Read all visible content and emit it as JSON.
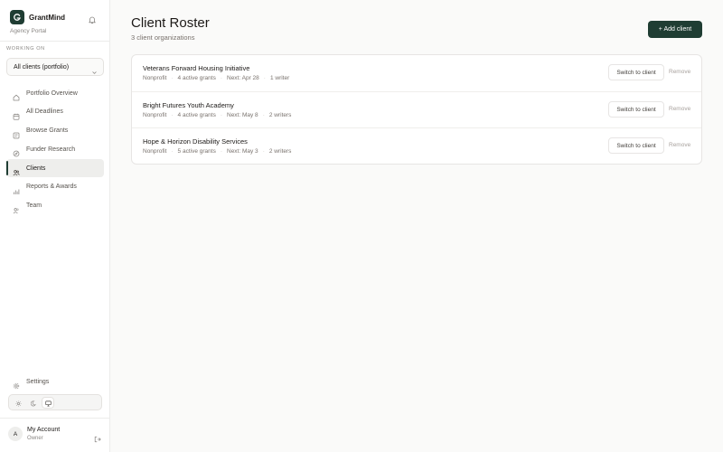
{
  "brand": {
    "name": "GrantMind",
    "subtitle": "Agency Portal"
  },
  "workspace": {
    "label": "WORKING ON",
    "selected": "All clients (portfolio)"
  },
  "nav": [
    {
      "label": "Portfolio Overview",
      "icon": "home-icon",
      "active": false
    },
    {
      "label": "All Deadlines",
      "icon": "calendar-icon",
      "active": false
    },
    {
      "label": "Browse Grants",
      "icon": "search-icon",
      "active": false
    },
    {
      "label": "Funder Research",
      "icon": "compass-icon",
      "active": false
    },
    {
      "label": "Clients",
      "icon": "users-icon",
      "active": true
    },
    {
      "label": "Reports & Awards",
      "icon": "bar-chart-icon",
      "active": false
    },
    {
      "label": "Team",
      "icon": "team-icon",
      "active": false
    }
  ],
  "settings": {
    "label": "Settings"
  },
  "theme": {
    "options": [
      "light",
      "dark",
      "system"
    ],
    "selected": "system"
  },
  "account": {
    "initial": "A",
    "name": "My Account",
    "role": "Owner"
  },
  "page": {
    "title": "Client Roster",
    "subtitle": "3 client organizations",
    "add_button": "+ Add client"
  },
  "clients": [
    {
      "name": "Veterans Forward Housing Initiative",
      "type": "Nonprofit",
      "grants": "4 active grants",
      "next": "Next: Apr 28",
      "writers": "1 writer",
      "switch_label": "Switch to client",
      "remove_label": "Remove"
    },
    {
      "name": "Bright Futures Youth Academy",
      "type": "Nonprofit",
      "grants": "4 active grants",
      "next": "Next: May 8",
      "writers": "2 writers",
      "switch_label": "Switch to client",
      "remove_label": "Remove"
    },
    {
      "name": "Hope & Horizon Disability Services",
      "type": "Nonprofit",
      "grants": "5 active grants",
      "next": "Next: May 3",
      "writers": "2 writers",
      "switch_label": "Switch to client",
      "remove_label": "Remove"
    }
  ],
  "colors": {
    "accent": "#1f3d33",
    "background": "#fafaf9",
    "muted_text": "#78716c"
  }
}
